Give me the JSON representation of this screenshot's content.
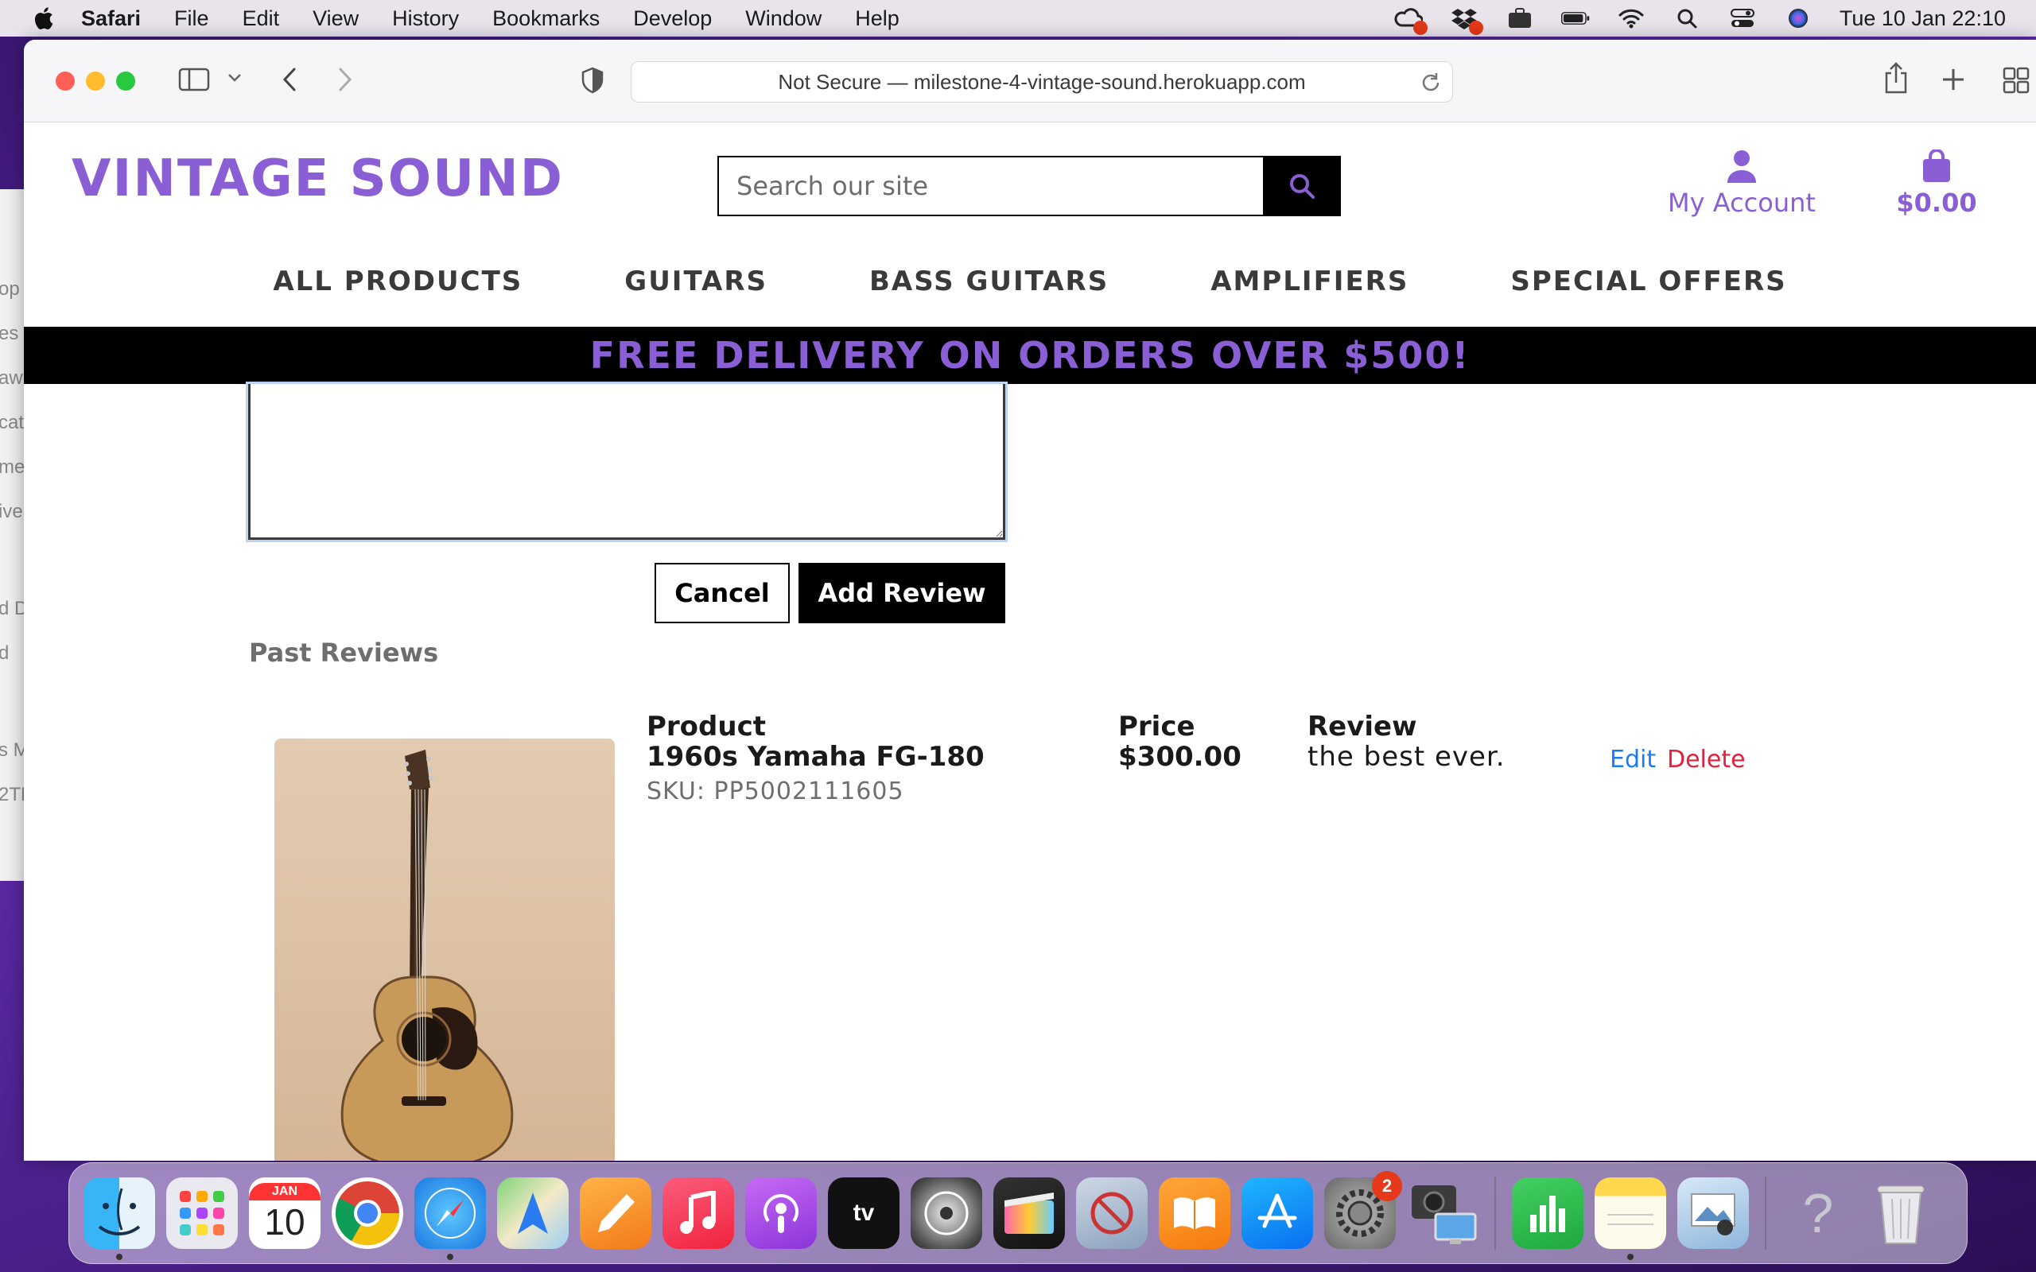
{
  "menubar": {
    "app_name": "Safari",
    "items": [
      "File",
      "Edit",
      "View",
      "History",
      "Bookmarks",
      "Develop",
      "Window",
      "Help"
    ],
    "clock": "Tue 10 Jan  22:10"
  },
  "background_window_fragments": [
    "op",
    "es",
    "aw",
    "cat",
    "me",
    "ive",
    "d D",
    "d",
    "s M",
    "2TE"
  ],
  "browser": {
    "address_text": "Not Secure — milestone-4-vintage-sound.herokuapp.com"
  },
  "site": {
    "brand": "VINTAGE SOUND",
    "search": {
      "placeholder": "Search our site",
      "value": ""
    },
    "account_label": "My Account",
    "cart_total": "$0.00",
    "nav": [
      "ALL PRODUCTS",
      "GUITARS",
      "BASS GUITARS",
      "AMPLIFIERS",
      "SPECIAL OFFERS"
    ],
    "banner": "FREE DELIVERY ON ORDERS OVER $500!",
    "colors": {
      "brand": "#8a5fd6",
      "edit": "#1b7cf2",
      "delete": "#e0223c"
    }
  },
  "review_form": {
    "cancel_label": "Cancel",
    "submit_label": "Add Review"
  },
  "past_reviews": {
    "title": "Past Reviews",
    "headers": {
      "product": "Product",
      "price": "Price",
      "review": "Review"
    },
    "rows": [
      {
        "product": "1960s Yamaha FG-180",
        "sku": "SKU: PP5002111605",
        "price": "$300.00",
        "review": "the best ever.",
        "edit_label": "Edit",
        "delete_label": "Delete"
      }
    ]
  },
  "dock": {
    "calendar_month": "JAN",
    "calendar_day": "10",
    "settings_badge": "2",
    "apps": [
      "finder",
      "launchpad",
      "calendar",
      "chrome",
      "safari",
      "maps",
      "pages",
      "music",
      "podcasts",
      "apple-tv",
      "logic",
      "final-cut",
      "utility",
      "books",
      "app-store",
      "system-preferences",
      "screen-sharing",
      "numbers",
      "notes",
      "preview",
      "help",
      "trash"
    ]
  }
}
